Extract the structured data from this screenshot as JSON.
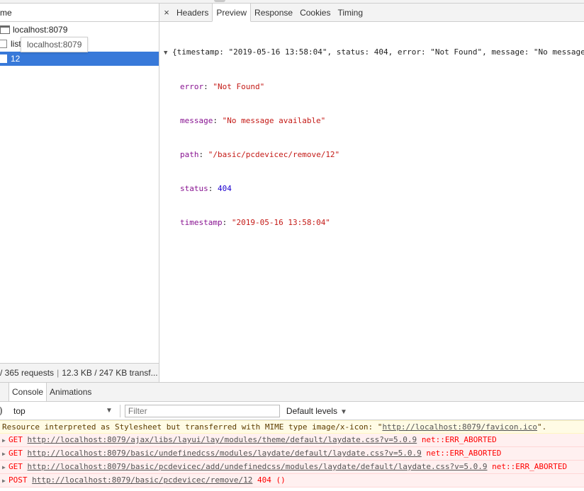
{
  "left_panel": {
    "header": "me",
    "requests": [
      {
        "name": "localhost:8079",
        "icon": "document-icon"
      },
      {
        "name": "list"
      },
      {
        "name": "12",
        "selected": true
      }
    ],
    "tooltip": "localhost:8079",
    "summary": {
      "requests": "/ 365 requests",
      "separator": "|",
      "transferred": "12.3 KB / 247 KB transf..."
    }
  },
  "detail_panel": {
    "close_glyph": "×",
    "tabs": [
      "Headers",
      "Preview",
      "Response",
      "Cookies",
      "Timing"
    ],
    "active_tab": "Preview",
    "preview": {
      "summary": "{timestamp: \"2019-05-16 13:58:04\", status: 404, error: \"Not Found\", message: \"No message",
      "props": [
        {
          "key": "error",
          "value": "\"Not Found\"",
          "kind": "string"
        },
        {
          "key": "message",
          "value": "\"No message available\"",
          "kind": "string"
        },
        {
          "key": "path",
          "value": "\"/basic/pcdevicec/remove/12\"",
          "kind": "string"
        },
        {
          "key": "status",
          "value": "404",
          "kind": "number"
        },
        {
          "key": "timestamp",
          "value": "\"2019-05-16 13:58:04\"",
          "kind": "string"
        }
      ]
    }
  },
  "drawer": {
    "tabs": [
      "Console",
      "Animations"
    ],
    "active_tab": "Console",
    "toolbar": {
      "context": "top",
      "filter_placeholder": "Filter",
      "levels": "Default levels"
    },
    "messages": [
      {
        "type": "warning",
        "text": "Resource interpreted as Stylesheet but transferred with MIME type image/x-icon: \"",
        "link": "http://localhost:8079/favicon.ico",
        "suffix": "\"."
      },
      {
        "type": "error",
        "method": "GET",
        "link": "http://localhost:8079/ajax/libs/layui/lay/modules/theme/default/laydate.css?v=5.0.9",
        "suffix": "net::ERR_ABORTED"
      },
      {
        "type": "error",
        "method": "GET",
        "link": "http://localhost:8079/basic/undefinedcss/modules/laydate/default/laydate.css?v=5.0.9",
        "suffix": "net::ERR_ABORTED"
      },
      {
        "type": "error",
        "method": "GET",
        "link": "http://localhost:8079/basic/pcdevicec/add/undefinedcss/modules/laydate/default/laydate.css?v=5.0.9",
        "suffix": "net::ERR_ABORTED"
      },
      {
        "type": "error",
        "method": "POST",
        "link": "http://localhost:8079/basic/pcdevicec/remove/12",
        "suffix": "404 ()"
      }
    ]
  },
  "colors": {
    "selection": "#3879d9",
    "error_bg": "#fff0f0",
    "error_text": "#ff0000",
    "warning_bg": "#fffbe5",
    "string": "#c41a16",
    "number": "#1c00cf",
    "key": "#881391"
  }
}
